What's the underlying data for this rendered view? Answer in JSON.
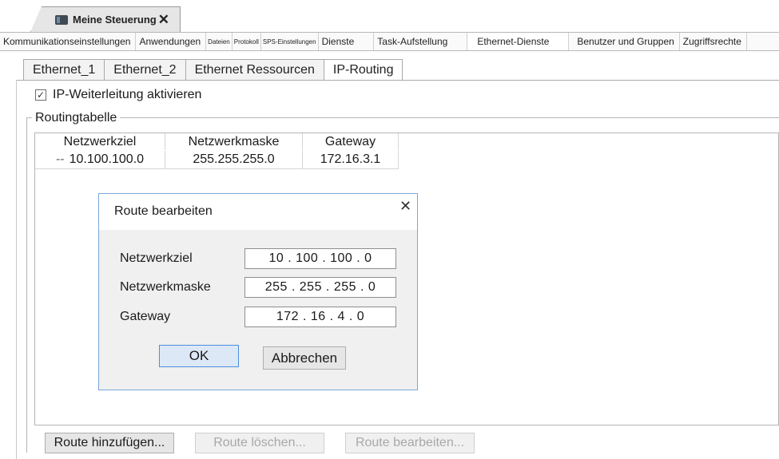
{
  "document_tab": {
    "title": "Meine Steuerung",
    "close_glyph": "✕",
    "icon": "controller-icon"
  },
  "category_tabs": [
    {
      "label": "Kommunikationseinstellungen",
      "size": "normal"
    },
    {
      "label": "Anwendungen",
      "size": "normal"
    },
    {
      "label": "Dateien",
      "size": "tiny"
    },
    {
      "label": "Protokoll",
      "size": "tiny"
    },
    {
      "label": "SPS-Einstellungen",
      "size": "tiny"
    },
    {
      "label": "Dienste",
      "size": "normal"
    },
    {
      "label": "Task-Aufstellung",
      "size": "normal"
    },
    {
      "label": "Ethernet-Dienste",
      "size": "normal",
      "active": true
    },
    {
      "label": "Benutzer und Gruppen",
      "size": "normal"
    },
    {
      "label": "Zugriffsrechte",
      "size": "normal"
    }
  ],
  "sub_tabs": [
    {
      "label": "Ethernet_1"
    },
    {
      "label": "Ethernet_2"
    },
    {
      "label": "Ethernet Ressourcen"
    },
    {
      "label": "IP-Routing",
      "active": true
    }
  ],
  "ip_forwarding": {
    "label": "IP-Weiterleitung aktivieren",
    "checked": true,
    "check_glyph": "✓"
  },
  "routing_table": {
    "legend": "Routingtabelle",
    "columns": [
      "Netzwerkziel",
      "Netzwerkmaske",
      "Gateway"
    ],
    "rows": [
      {
        "marker": "--",
        "destination": "10.100.100.0",
        "mask": "255.255.255.0",
        "gateway": "172.16.3.1"
      }
    ]
  },
  "dialog": {
    "title": "Route bearbeiten",
    "close_glyph": "✕",
    "fields": {
      "destination": {
        "label": "Netzwerkziel",
        "value": "10 . 100 . 100 . 0"
      },
      "mask": {
        "label": "Netzwerkmaske",
        "value": "255 . 255 . 255 . 0"
      },
      "gateway": {
        "label": "Gateway",
        "value": "172 . 16 . 4 . 0"
      }
    },
    "ok_label": "OK",
    "cancel_label": "Abbrechen"
  },
  "buttons": {
    "add": {
      "label": "Route hinzufügen...",
      "enabled": true
    },
    "delete": {
      "label": "Route löschen...",
      "enabled": false
    },
    "edit": {
      "label": "Route bearbeiten...",
      "enabled": false
    }
  },
  "colors": {
    "dialog_border": "#7aa7d9",
    "ok_border": "#4c8fdb",
    "ok_fill": "#dde8f6"
  }
}
